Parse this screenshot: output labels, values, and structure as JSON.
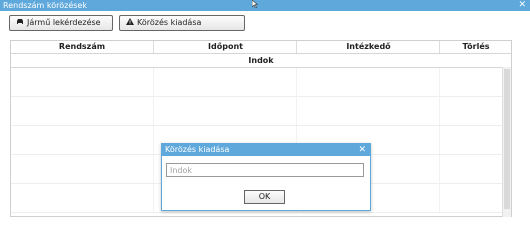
{
  "window": {
    "title": "Rendszám körözések",
    "close_glyph": "✕"
  },
  "toolbar": {
    "vehicle_query_label": "Jármű lekérdezése",
    "vehicle_query_icon": "car-icon",
    "issue_label": "Körözés kiadása",
    "issue_icon": "warning-icon"
  },
  "table": {
    "columns": [
      "Rendszám",
      "Időpont",
      "Intézkedő",
      "Törlés"
    ],
    "subheader": "Indok",
    "rows": [
      {},
      {},
      {},
      {},
      {}
    ]
  },
  "dialog": {
    "title": "Körözés kiadása",
    "close_glyph": "✕",
    "input_placeholder": "Indok",
    "ok_label": "OK"
  },
  "colors": {
    "accent": "#5fa8dc"
  }
}
